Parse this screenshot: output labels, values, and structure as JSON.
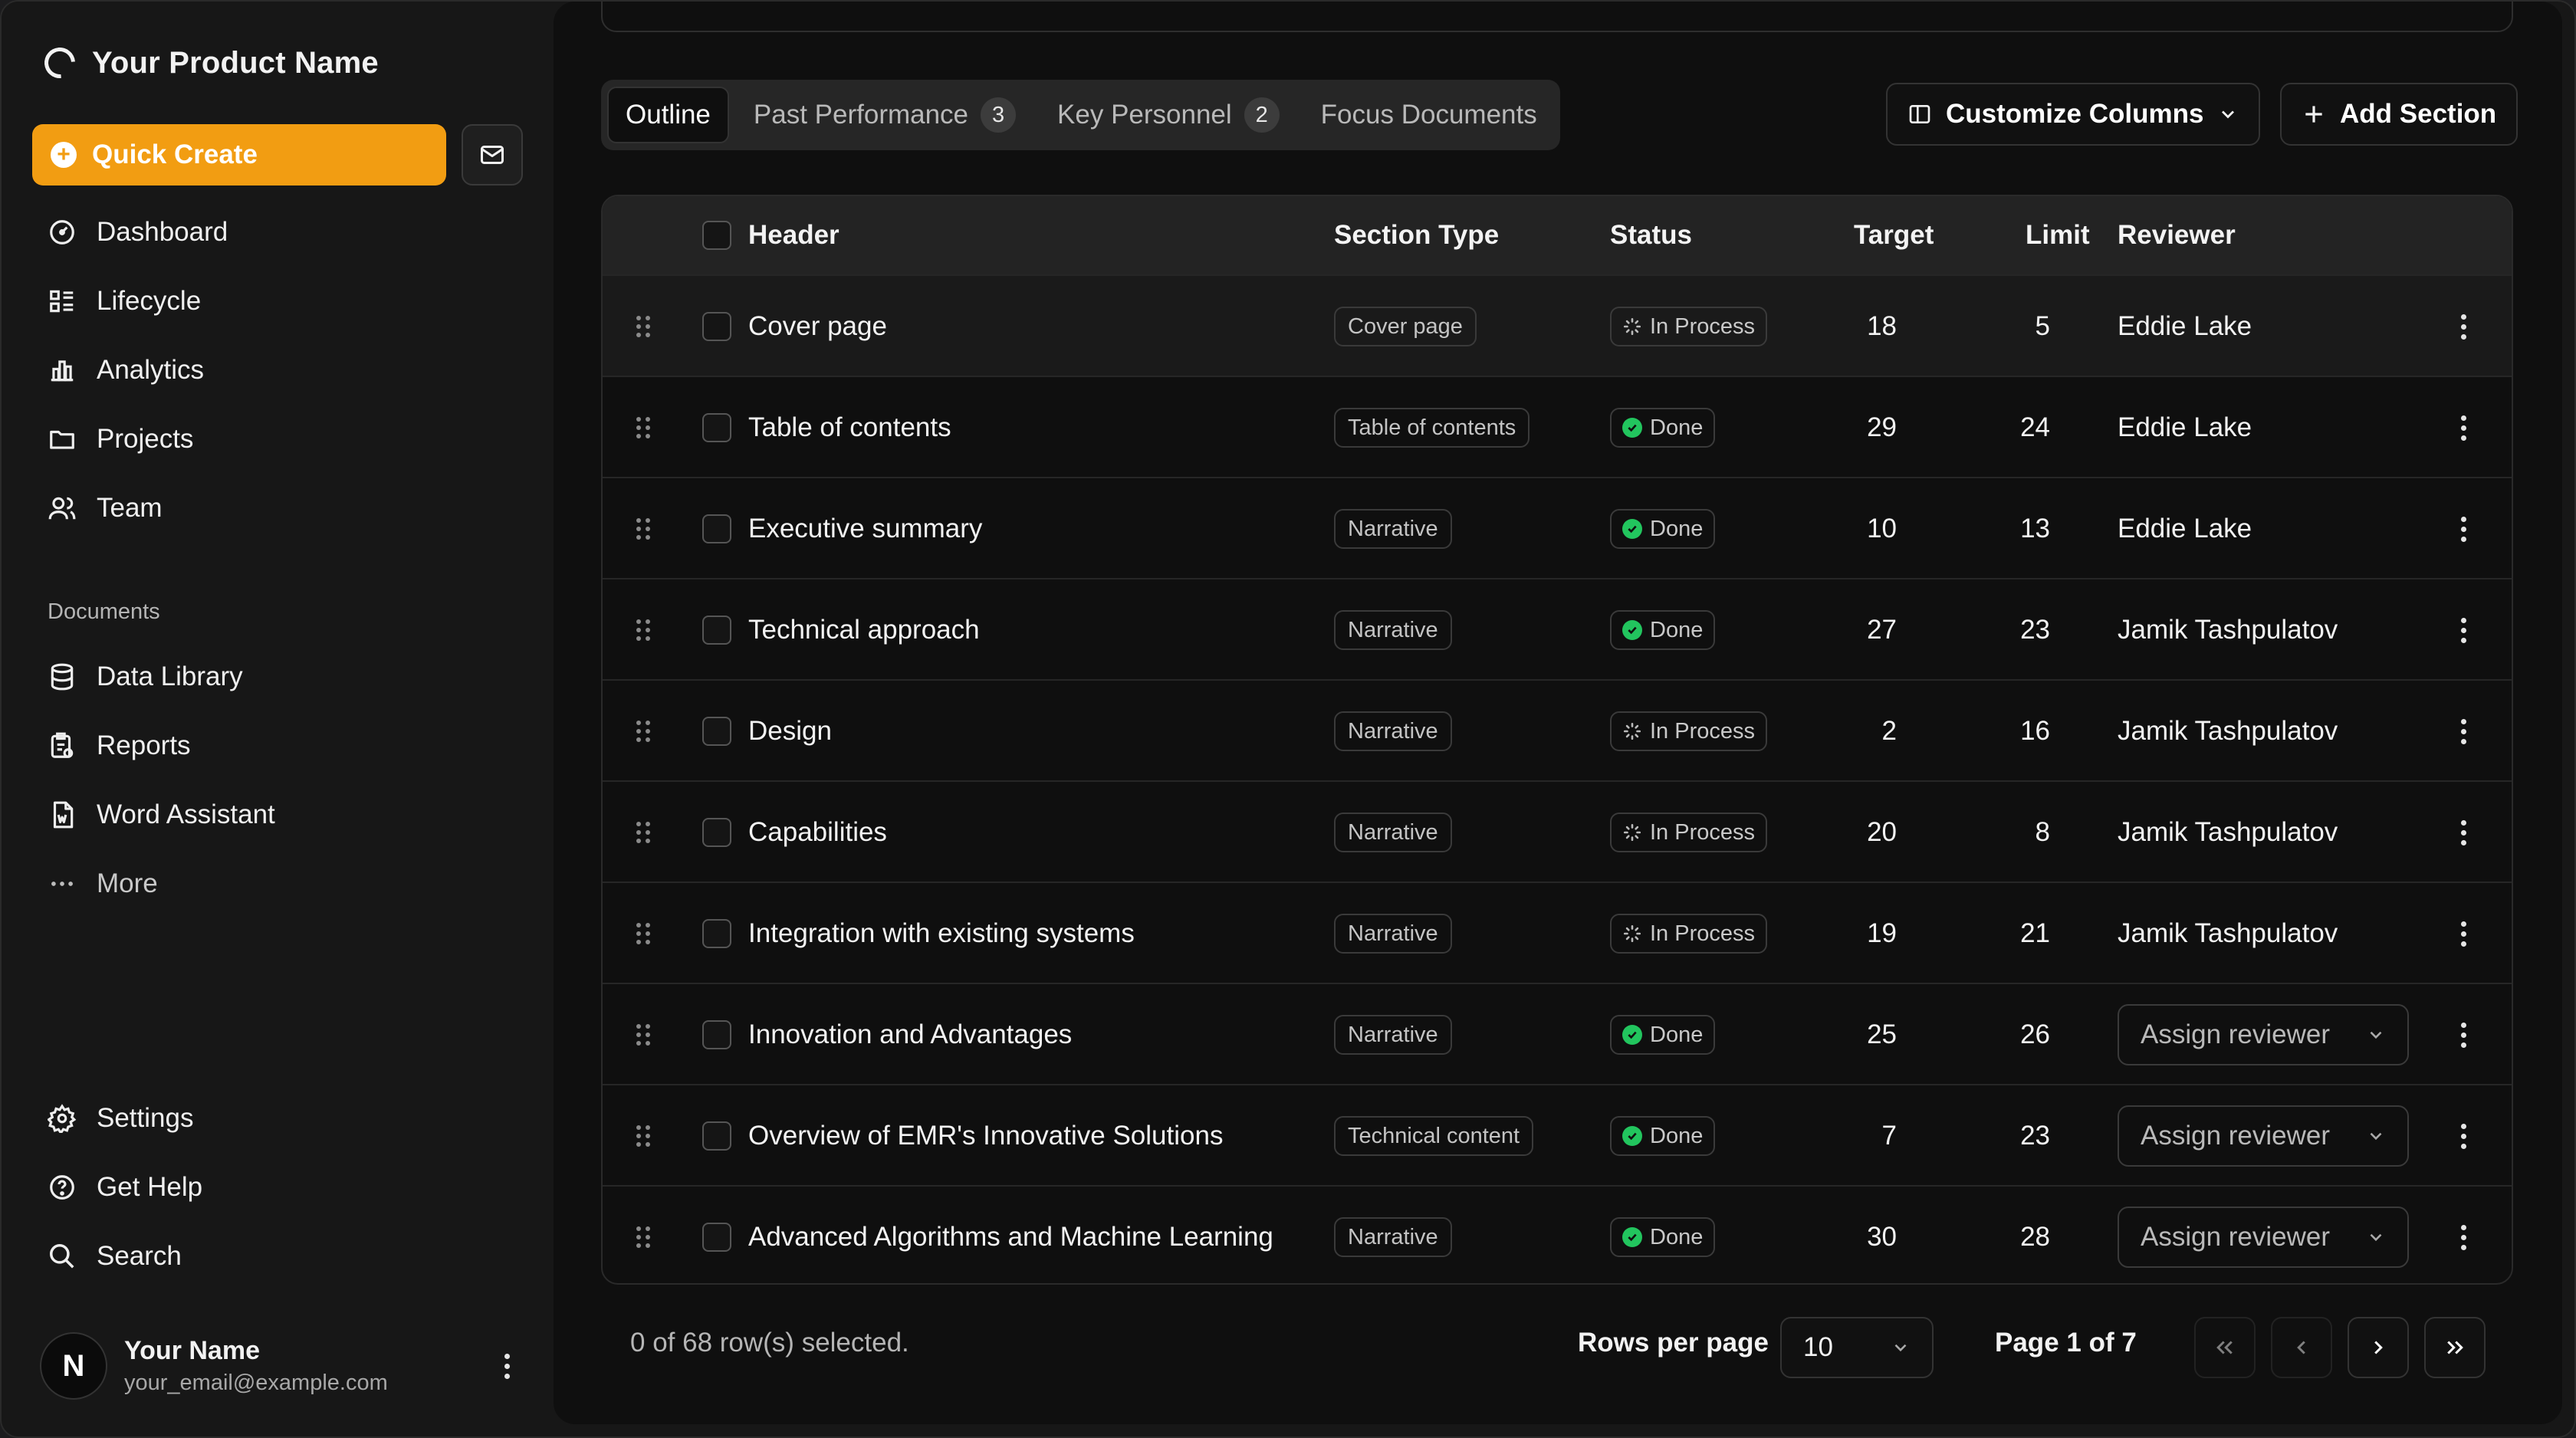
{
  "brand": {
    "name": "Your Product Name"
  },
  "quick_create": {
    "label": "Quick Create"
  },
  "nav": [
    {
      "label": "Dashboard",
      "icon": "dashboard-icon"
    },
    {
      "label": "Lifecycle",
      "icon": "lifecycle-icon"
    },
    {
      "label": "Analytics",
      "icon": "analytics-icon"
    },
    {
      "label": "Projects",
      "icon": "folder-icon"
    },
    {
      "label": "Team",
      "icon": "team-icon"
    }
  ],
  "documents": {
    "label": "Documents",
    "items": [
      {
        "label": "Data Library",
        "icon": "database-icon"
      },
      {
        "label": "Reports",
        "icon": "reports-icon"
      },
      {
        "label": "Word Assistant",
        "icon": "word-file-icon"
      },
      {
        "label": "More",
        "icon": "more-icon"
      }
    ]
  },
  "secondary_nav": [
    {
      "label": "Settings",
      "icon": "settings-icon"
    },
    {
      "label": "Get Help",
      "icon": "help-icon"
    },
    {
      "label": "Search",
      "icon": "search-icon"
    }
  ],
  "user": {
    "name": "Your Name",
    "email": "your_email@example.com",
    "initial": "N"
  },
  "tabs": [
    {
      "label": "Outline",
      "badge": ""
    },
    {
      "label": "Past Performance",
      "badge": "3"
    },
    {
      "label": "Key Personnel",
      "badge": "2"
    },
    {
      "label": "Focus Documents",
      "badge": ""
    }
  ],
  "toolbar": {
    "customize_label": "Customize Columns",
    "add_label": "Add Section"
  },
  "table": {
    "headers": {
      "header": "Header",
      "section_type": "Section Type",
      "status": "Status",
      "target": "Target",
      "limit": "Limit",
      "reviewer": "Reviewer"
    },
    "assign_label": "Assign reviewer",
    "rows": [
      {
        "header": "Cover page",
        "type": "Cover page",
        "status": "In Process",
        "target": "18",
        "limit": "5",
        "reviewer": "Eddie Lake"
      },
      {
        "header": "Table of contents",
        "type": "Table of contents",
        "status": "Done",
        "target": "29",
        "limit": "24",
        "reviewer": "Eddie Lake"
      },
      {
        "header": "Executive summary",
        "type": "Narrative",
        "status": "Done",
        "target": "10",
        "limit": "13",
        "reviewer": "Eddie Lake"
      },
      {
        "header": "Technical approach",
        "type": "Narrative",
        "status": "Done",
        "target": "27",
        "limit": "23",
        "reviewer": "Jamik Tashpulatov"
      },
      {
        "header": "Design",
        "type": "Narrative",
        "status": "In Process",
        "target": "2",
        "limit": "16",
        "reviewer": "Jamik Tashpulatov"
      },
      {
        "header": "Capabilities",
        "type": "Narrative",
        "status": "In Process",
        "target": "20",
        "limit": "8",
        "reviewer": "Jamik Tashpulatov"
      },
      {
        "header": "Integration with existing systems",
        "type": "Narrative",
        "status": "In Process",
        "target": "19",
        "limit": "21",
        "reviewer": "Jamik Tashpulatov"
      },
      {
        "header": "Innovation and Advantages",
        "type": "Narrative",
        "status": "Done",
        "target": "25",
        "limit": "26",
        "reviewer": ""
      },
      {
        "header": "Overview of EMR's Innovative Solutions",
        "type": "Technical content",
        "status": "Done",
        "target": "7",
        "limit": "23",
        "reviewer": ""
      },
      {
        "header": "Advanced Algorithms and Machine Learning",
        "type": "Narrative",
        "status": "Done",
        "target": "30",
        "limit": "28",
        "reviewer": ""
      }
    ]
  },
  "footer": {
    "selection": "0 of 68 row(s) selected.",
    "rows_per_page_label": "Rows per page",
    "rows_per_page_value": "10",
    "page_label": "Page 1 of 7"
  },
  "colors": {
    "accent": "#f29d12",
    "done": "#22c55e",
    "background": "#0f0f0f",
    "sidebar": "#171717"
  }
}
